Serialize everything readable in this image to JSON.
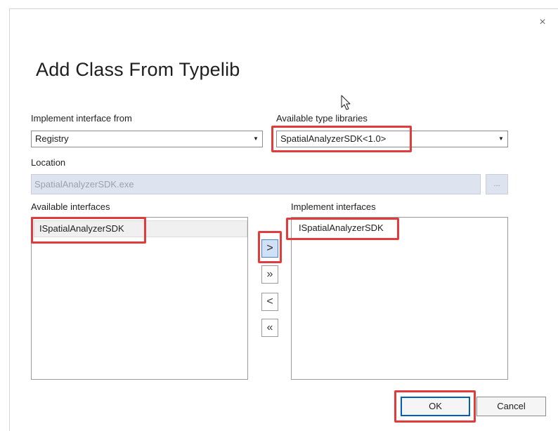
{
  "dialog": {
    "title": "Add Class From Typelib",
    "close_glyph": "×"
  },
  "implement_from": {
    "label": "Implement interface from",
    "value": "Registry"
  },
  "type_libraries": {
    "label": "Available type libraries",
    "value": "SpatialAnalyzerSDK<1.0>"
  },
  "location": {
    "label": "Location",
    "value": "SpatialAnalyzerSDK.exe",
    "browse_label": "..."
  },
  "available_interfaces": {
    "label": "Available interfaces",
    "items": [
      "ISpatialAnalyzerSDK"
    ]
  },
  "implement_interfaces": {
    "label": "Implement interfaces",
    "items": [
      "ISpatialAnalyzerSDK"
    ]
  },
  "move_buttons": {
    "add_one": ">",
    "add_all": "»",
    "remove_one": "<",
    "remove_all": "«"
  },
  "footer": {
    "ok_label": "OK",
    "cancel_label": "Cancel"
  },
  "colors": {
    "highlight": "#e23b3b",
    "accent": "#005fb8",
    "selected_button": "#cfe0f7",
    "disabled_field": "#dde4ef"
  },
  "icons": {
    "close": "close-icon",
    "dropdown": "chevron-down-icon",
    "cursor": "mouse-pointer-icon"
  }
}
